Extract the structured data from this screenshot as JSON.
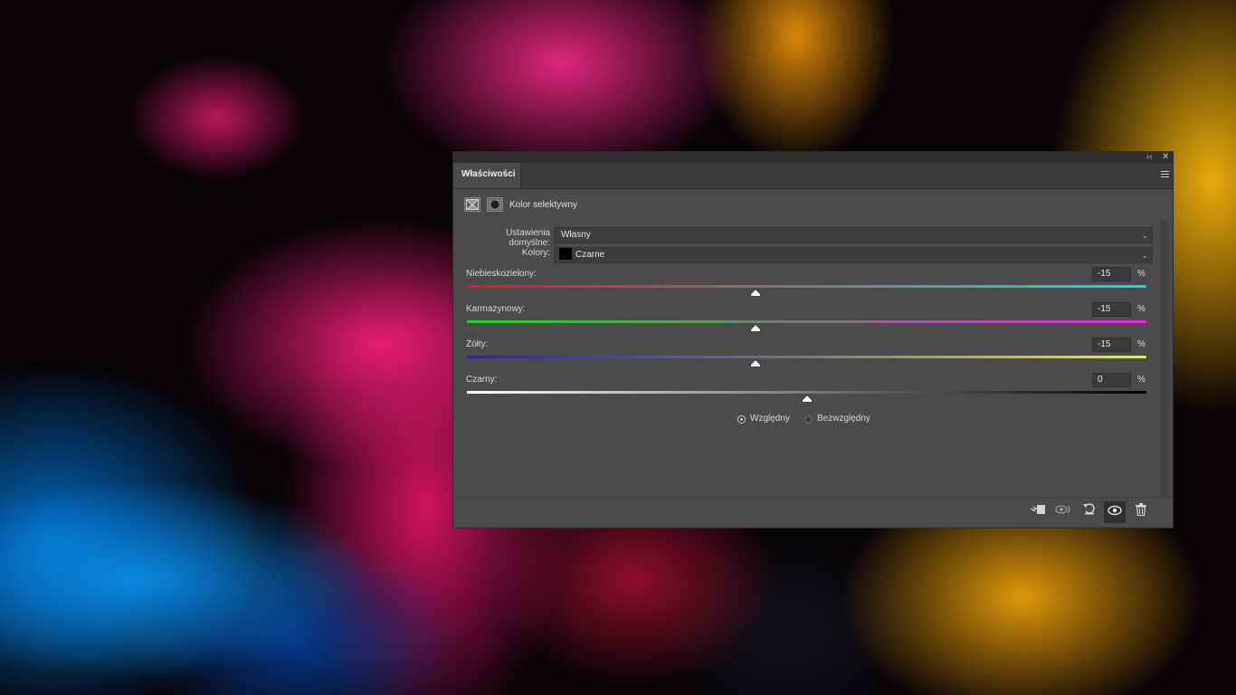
{
  "panel": {
    "tab_label": "Właściwości",
    "collapse_glyph": "‹‹",
    "close_glyph": "✕",
    "adjustment_title": "Kolor selektywny"
  },
  "preset": {
    "label": "Ustawienia domyślne:",
    "value": "Własny"
  },
  "colors": {
    "label": "Kolory:",
    "value": "Czarne",
    "swatch_color": "#000000"
  },
  "sliders": [
    {
      "label": "Niebieskozielony:",
      "value": "-15",
      "unit": "%",
      "gradient_from": "#e8161e",
      "gradient_to": "#16d9e8"
    },
    {
      "label": "Karmazynowy:",
      "value": "-15",
      "unit": "%",
      "gradient_from": "#1fd81f",
      "gradient_to": "#e61fe6"
    },
    {
      "label": "Żółty:",
      "value": "-15",
      "unit": "%",
      "gradient_from": "#1a1fe6",
      "gradient_to": "#f2f21a"
    },
    {
      "label": "Czarny:",
      "value": "0",
      "unit": "%",
      "gradient_from": "#ffffff",
      "gradient_to": "#000000"
    }
  ],
  "method": {
    "relative_label": "Względny",
    "absolute_label": "Bezwzględny",
    "selected": "relative"
  },
  "footer_icons": [
    "clip-to-layer-icon",
    "view-previous-state-icon",
    "reset-icon",
    "visibility-eye-icon",
    "trash-icon"
  ]
}
